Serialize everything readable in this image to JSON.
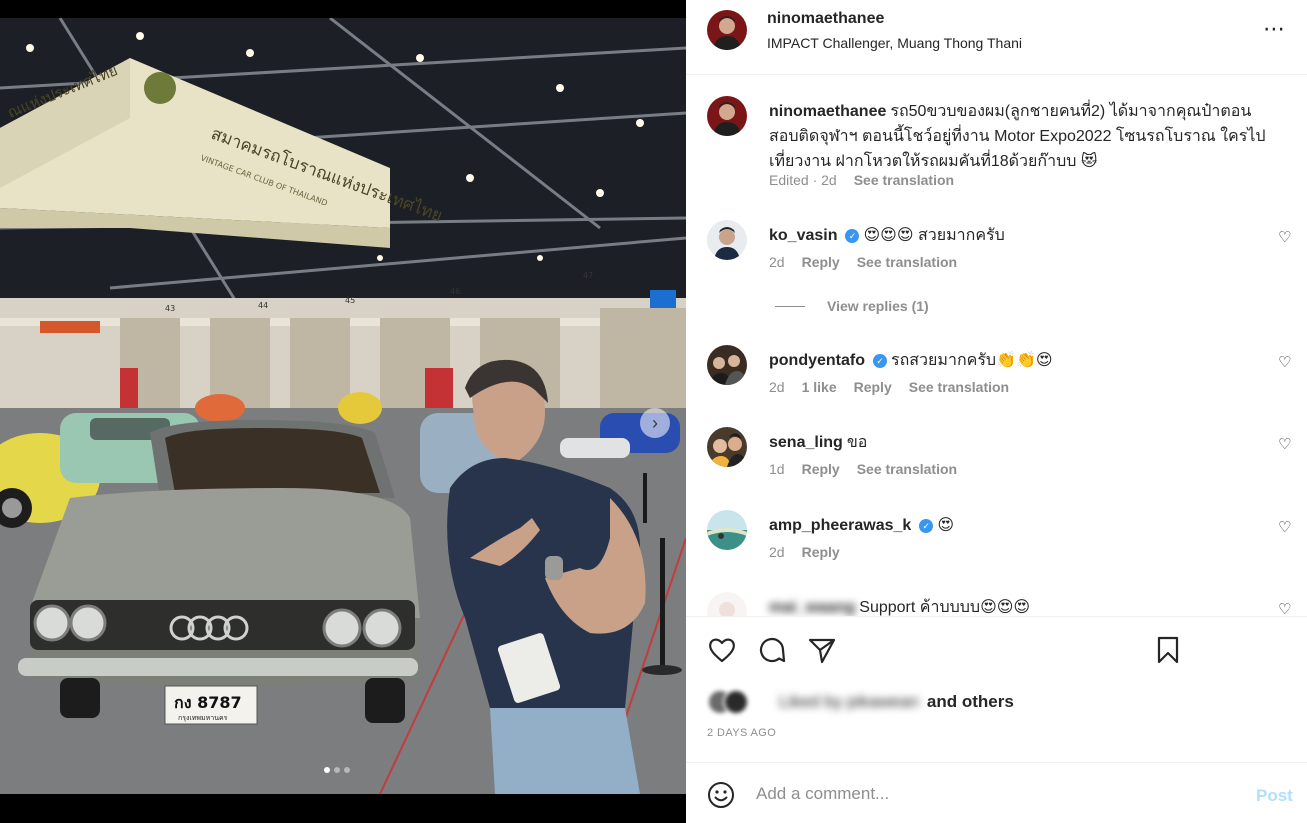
{
  "post": {
    "username": "ninomaethanee",
    "location": "IMPACT Challenger, Muang Thong Thani",
    "more_icon": "⋯",
    "caption": "รถ50ขวบของผม(ลูกชายคนที่2) ได้มาจากคุณป๋าตอนสอบติดจุฬาฯ ตอนนี้โชว์อยู่ที่งาน Motor Expo2022 โซนรถโบราณ ใครไปเที่ยวงาน ฝากโหวตให้รถผมคันที่18ด้วยก๊าบบ 😻",
    "caption_meta": {
      "edited": "Edited · 2d",
      "see_translation": "See translation"
    }
  },
  "photo": {
    "banner_text": "สมาคมรถโบราณแห่งประเทศไทย",
    "banner_sub": "VINTAGE CAR CLUB OF THAILAND",
    "banner_left": "ณแห่งประเทศไทย",
    "pillar_numbers": [
      "43",
      "44",
      "45",
      "46",
      "47"
    ],
    "plate": "กง 8787",
    "plate_sub": "กรุงเทพมหานคร",
    "next_icon": "›",
    "dots": 3,
    "active_dot": 0
  },
  "comments": [
    {
      "username": "ko_vasin",
      "verified": true,
      "text": "😍😍😍 สวยมากครับ",
      "time": "2d",
      "likes": "",
      "reply": "Reply",
      "see_translation": "See translation"
    },
    {
      "username": "pondyentafo",
      "verified": true,
      "text": "รถสวยมากครับ👏👏😍",
      "time": "2d",
      "likes": "1 like",
      "reply": "Reply",
      "see_translation": "See translation"
    },
    {
      "username": "sena_ling",
      "verified": false,
      "text": "ขอ",
      "time": "1d",
      "likes": "",
      "reply": "Reply",
      "see_translation": "See translation"
    },
    {
      "username": "amp_pheerawas_k",
      "verified": true,
      "text": "😍",
      "time": "2d",
      "likes": "",
      "reply": "Reply",
      "see_translation": ""
    },
    {
      "username": "mai_waang",
      "verified": false,
      "text": "Support ค้าบบบบ😍😍😍",
      "time": "",
      "likes": "",
      "reply": "",
      "see_translation": ""
    }
  ],
  "view_replies": "View replies (1)",
  "likes": {
    "blurred": "Liked by pikawean",
    "and_others": "and others"
  },
  "time_ago": "2 DAYS AGO",
  "comment_input": {
    "placeholder": "Add a comment...",
    "post_label": "Post"
  },
  "icons": [
    "heart-icon",
    "comment-icon",
    "share-icon",
    "bookmark-icon",
    "emoji-icon",
    "more-icon",
    "verified-icon",
    "chevron-right-icon"
  ],
  "colors": {
    "link_blue": "#0095f6",
    "post_disabled": "#b2dffc",
    "verified": "#3897f0",
    "muted": "#8e8e8e"
  }
}
